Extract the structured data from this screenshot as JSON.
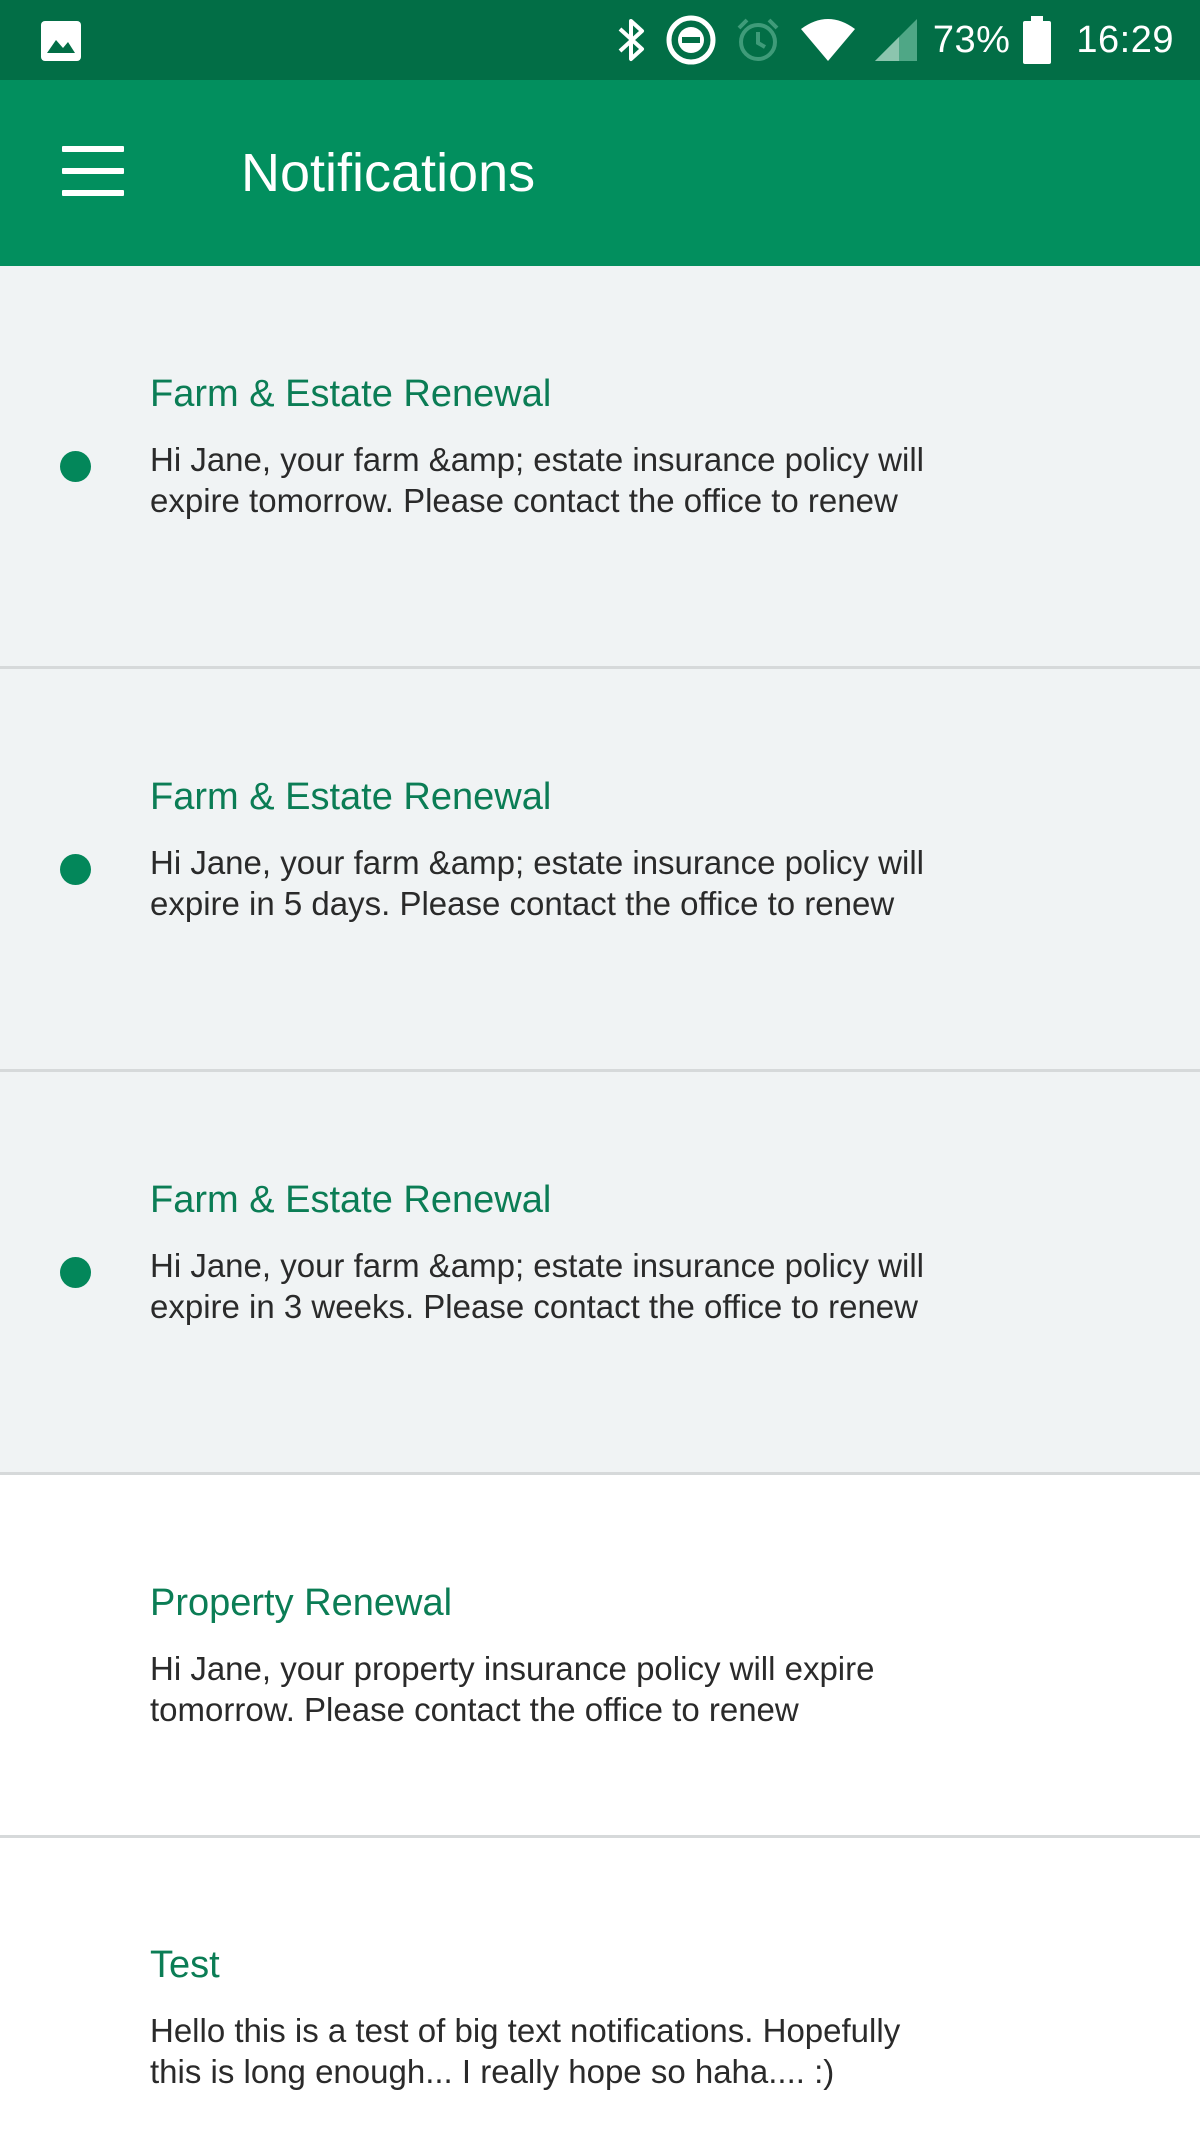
{
  "status_bar": {
    "battery": "73%",
    "time": "16:29",
    "icons": [
      "gallery-icon",
      "bluetooth-icon",
      "do-not-disturb-icon",
      "alarm-icon",
      "wifi-icon",
      "cellular-signal-icon",
      "battery-icon"
    ]
  },
  "app_bar": {
    "title": "Notifications",
    "menu_icon": "hamburger-menu-icon"
  },
  "colors": {
    "status_bar": "#026e46",
    "app_bar": "#028f5e",
    "accent": "#03875a",
    "unread_bg": "#f0f3f4",
    "read_bg": "#ffffff"
  },
  "notifications": [
    {
      "title": "Farm & Estate Renewal",
      "body": "Hi Jane, your farm &amp; estate insurance policy will expire tomorrow. Please contact the office to renew",
      "unread": true
    },
    {
      "title": "Farm & Estate Renewal",
      "body": "Hi Jane, your farm &amp; estate insurance policy will expire in 5 days. Please contact the office to renew",
      "unread": true
    },
    {
      "title": "Farm & Estate Renewal",
      "body": "Hi Jane, your farm &amp; estate insurance policy will expire in 3 weeks. Please contact the office to renew",
      "unread": true
    },
    {
      "title": "Property Renewal",
      "body": "Hi Jane, your property insurance policy will expire tomorrow. Please contact the office to renew",
      "unread": false
    },
    {
      "title": "Test",
      "body": "Hello this is a test of big text notifications. Hopefully this is long enough... I really hope so haha.... :)",
      "unread": false
    }
  ]
}
